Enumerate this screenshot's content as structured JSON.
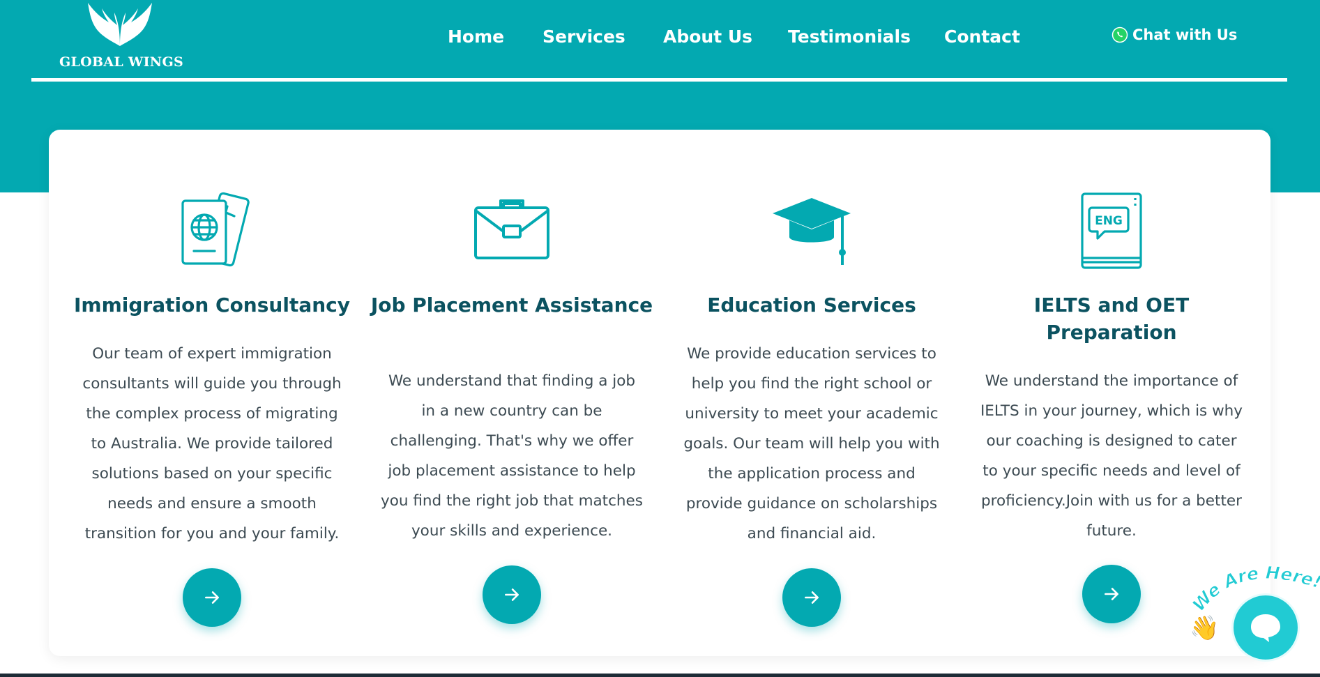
{
  "brand": {
    "name": "GLOBAL WINGS"
  },
  "nav": {
    "items": [
      {
        "label": "Home"
      },
      {
        "label": "Services"
      },
      {
        "label": "About Us"
      },
      {
        "label": "Testimonials"
      },
      {
        "label": "Contact"
      }
    ],
    "chat_label": "Chat with Us"
  },
  "services": [
    {
      "icon": "passport-ticket-icon",
      "title": "Immigration Consultancy",
      "description": "Our team of expert immigration consultants will guide you through the complex process of migrating to Australia. We provide tailored solutions based on your specific needs and ensure a smooth transition for you and your family."
    },
    {
      "icon": "briefcase-icon",
      "title": "Job Placement Assistance",
      "description": "We understand that finding a job in a new country can be challenging. That's why we offer job placement assistance to help you find the right job that matches your skills and experience."
    },
    {
      "icon": "graduation-cap-icon",
      "title": "Education Services",
      "description": "We provide education services to help you find the right school or university to meet your academic goals. Our team will help you with the application process and provide guidance on scholarships and financial aid."
    },
    {
      "icon": "english-book-icon",
      "icon_text": "ENG",
      "title": "IELTS and OET Preparation",
      "description": "We understand the importance of IELTS in your journey, which is why our coaching is designed to cater to your specific needs and level of proficiency.Join with us for a better future."
    }
  ],
  "chat_widget": {
    "tagline": "We Are Here!"
  },
  "colors": {
    "brand_teal": "#03a9b1",
    "heading": "#0b5260",
    "body_text": "#3c4a52",
    "widget": "#21cbd3"
  }
}
